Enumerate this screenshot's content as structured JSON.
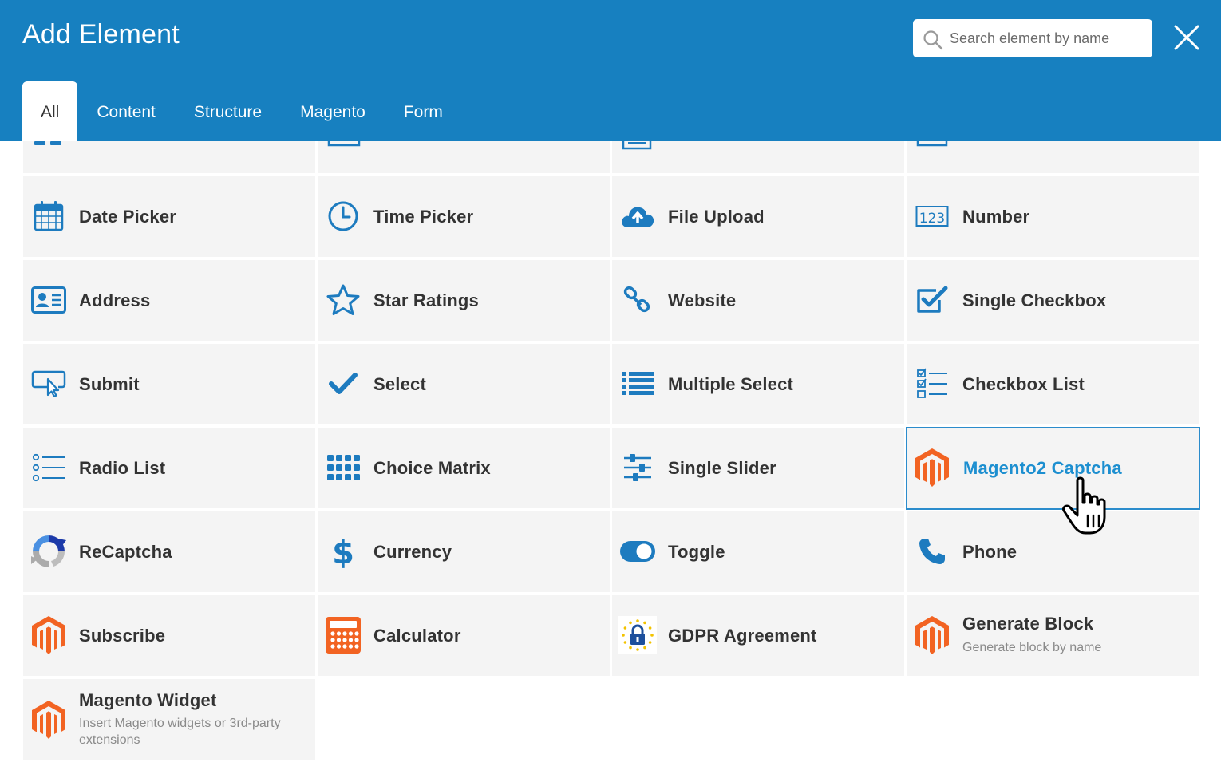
{
  "header": {
    "title": "Add Element",
    "search_placeholder": "Search element by name",
    "bg_color": "#1780c0"
  },
  "tabs": [
    {
      "label": "All",
      "active": true
    },
    {
      "label": "Content",
      "active": false
    },
    {
      "label": "Structure",
      "active": false
    },
    {
      "label": "Magento",
      "active": false
    },
    {
      "label": "Form",
      "active": false
    }
  ],
  "elements": {
    "date_picker": {
      "label": "Date Picker",
      "icon": "calendar-icon"
    },
    "time_picker": {
      "label": "Time Picker",
      "icon": "clock-icon"
    },
    "file_upload": {
      "label": "File Upload",
      "icon": "cloud-upload-icon"
    },
    "number": {
      "label": "Number",
      "icon": "number-123-icon"
    },
    "address": {
      "label": "Address",
      "icon": "address-card-icon"
    },
    "star_ratings": {
      "label": "Star Ratings",
      "icon": "star-icon"
    },
    "website": {
      "label": "Website",
      "icon": "link-icon"
    },
    "single_checkbox": {
      "label": "Single Checkbox",
      "icon": "checkbox-icon"
    },
    "submit": {
      "label": "Submit",
      "icon": "pointer-click-icon"
    },
    "select": {
      "label": "Select",
      "icon": "checkmark-icon"
    },
    "multiple_select": {
      "label": "Multiple Select",
      "icon": "list-icon"
    },
    "checkbox_list": {
      "label": "Checkbox List",
      "icon": "checkbox-list-icon"
    },
    "radio_list": {
      "label": "Radio List",
      "icon": "radio-list-icon"
    },
    "choice_matrix": {
      "label": "Choice Matrix",
      "icon": "grid-icon"
    },
    "single_slider": {
      "label": "Single Slider",
      "icon": "sliders-icon"
    },
    "magento2_captcha": {
      "label": "Magento2 Captcha",
      "icon": "magento-icon",
      "highlighted": true
    },
    "recaptcha": {
      "label": "ReCaptcha",
      "icon": "recaptcha-icon"
    },
    "currency": {
      "label": "Currency",
      "icon": "dollar-icon"
    },
    "toggle": {
      "label": "Toggle",
      "icon": "toggle-icon"
    },
    "phone": {
      "label": "Phone",
      "icon": "phone-icon"
    },
    "subscribe": {
      "label": "Subscribe",
      "icon": "magento-icon"
    },
    "calculator": {
      "label": "Calculator",
      "icon": "calculator-icon"
    },
    "gdpr_agreement": {
      "label": "GDPR Agreement",
      "icon": "gdpr-lock-icon"
    },
    "generate_block": {
      "label": "Generate Block",
      "desc": "Generate block by name",
      "icon": "magento-icon"
    },
    "magento_widget": {
      "label": "Magento Widget",
      "desc": "Insert Magento widgets or 3rd-party extensions",
      "icon": "magento-icon"
    }
  },
  "colors": {
    "accent_blue": "#1780c0",
    "icon_blue": "#1d7bbf",
    "magento_orange": "#f26322",
    "cell_bg": "#f4f4f4",
    "highlight_border": "#2b8ccc"
  }
}
